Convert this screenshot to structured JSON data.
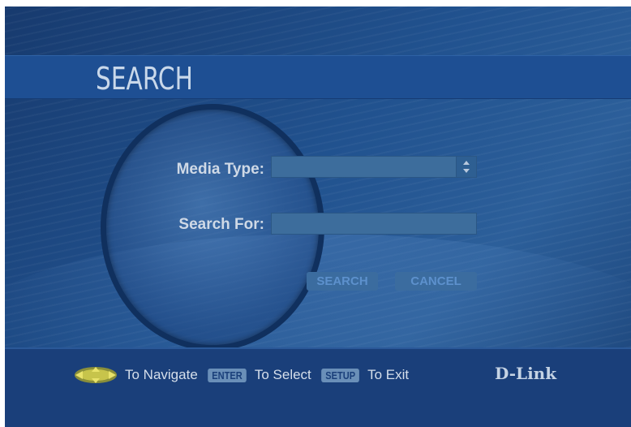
{
  "screen": {
    "title": "SEARCH"
  },
  "form": {
    "media_type_label": "Media Type:",
    "media_type_value": "",
    "search_for_label": "Search For:",
    "search_for_value": "",
    "search_button_label": "SEARCH",
    "cancel_button_label": "CANCEL"
  },
  "footer": {
    "navigate_text": "To Navigate",
    "enter_key": "ENTER",
    "select_text": "To Select",
    "setup_key": "SETUP",
    "exit_text": "To Exit",
    "logo": "D-Link"
  },
  "icons": {
    "nav": "directional-pad-icon",
    "spinner": "up-down-arrows-icon"
  },
  "colors": {
    "background": "#21528f",
    "title_band": "#1e4f93",
    "footer": "#1a3f7a",
    "button_text": "#5d91cd"
  }
}
